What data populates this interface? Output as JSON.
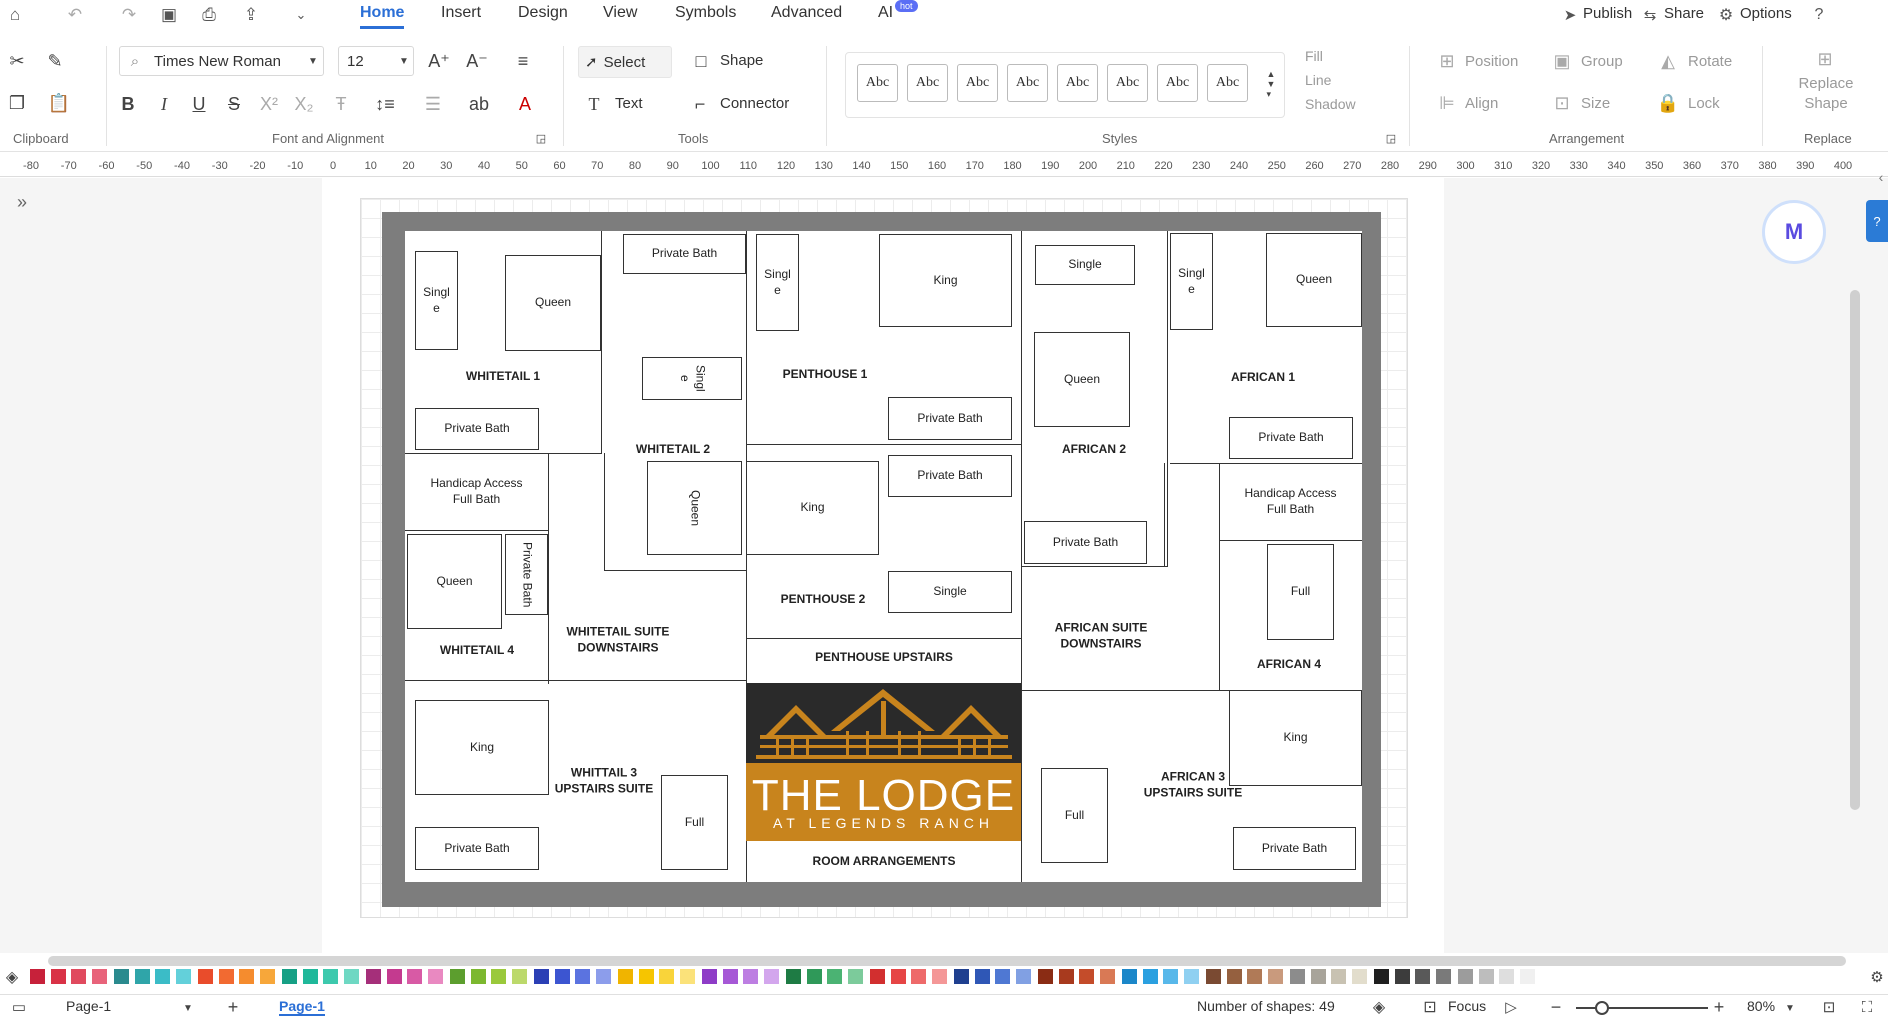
{
  "toolbar": {
    "tabs": [
      "Home",
      "Insert",
      "Design",
      "View",
      "Symbols",
      "Advanced",
      "AI"
    ],
    "hot_badge": "hot",
    "publish": "Publish",
    "share": "Share",
    "options": "Options"
  },
  "ribbon": {
    "font_name": "Times New Roman",
    "font_size": "12",
    "select": "Select",
    "shape": "Shape",
    "text": "Text",
    "connector": "Connector",
    "style_sample": "Abc",
    "fill": "Fill",
    "line": "Line",
    "shadow": "Shadow",
    "position": "Position",
    "group": "Group",
    "rotate": "Rotate",
    "align": "Align",
    "size": "Size",
    "lock": "Lock",
    "replace_shape": "Replace Shape",
    "groups": {
      "clipboard": "Clipboard",
      "font": "Font and Alignment",
      "tools": "Tools",
      "styles": "Styles",
      "arrangement": "Arrangement",
      "replace": "Replace"
    }
  },
  "ruler": [
    "-80",
    "-70",
    "-60",
    "-50",
    "-40",
    "-30",
    "-20",
    "-10",
    "0",
    "10",
    "20",
    "30",
    "40",
    "50",
    "60",
    "70",
    "80",
    "90",
    "100",
    "110",
    "120",
    "130",
    "140",
    "150",
    "160",
    "170",
    "180",
    "190",
    "200",
    "210",
    "220",
    "230",
    "240",
    "250",
    "260",
    "270",
    "280",
    "290",
    "300",
    "310",
    "320",
    "330",
    "340",
    "350",
    "360",
    "370",
    "380",
    "390",
    "400"
  ],
  "rooms": {
    "whitetail1": "WHITETAIL 1",
    "whitetail2": "WHITETAIL 2",
    "whitetail4": "WHITETAIL 4",
    "whitetail_suite": "WHITETAIL SUITE\nDOWNSTAIRS",
    "whittail3": "WHITTAIL 3\nUPSTAIRS SUITE",
    "penthouse1": "PENTHOUSE 1",
    "penthouse2": "PENTHOUSE 2",
    "penthouse_up": "PENTHOUSE UPSTAIRS",
    "african1": "AFRICAN 1",
    "african2": "AFRICAN 2",
    "african4": "AFRICAN 4",
    "african_suite": "AFRICAN SUITE\nDOWNSTAIRS",
    "african3": "AFRICAN 3\nUPSTAIRS SUITE",
    "room_arr": "ROOM ARRANGEMENTS"
  },
  "items": {
    "single_split": "Singl\ne",
    "single": "Single",
    "queen": "Queen",
    "king": "King",
    "full": "Full",
    "private_bath": "Private Bath",
    "handicap": "Handicap Access\nFull Bath"
  },
  "logo": {
    "title": "THE LODGE",
    "subtitle": "AT LEGENDS RANCH"
  },
  "palette": [
    "#c7213a",
    "#d93246",
    "#e04a5e",
    "#e8637a",
    "#2a8a8e",
    "#2fa5a9",
    "#3bbcc7",
    "#63d0da",
    "#e94c2b",
    "#f26a31",
    "#f58c2e",
    "#f7a73a",
    "#16a085",
    "#1fb89a",
    "#3dc9ad",
    "#6ed8c3",
    "#a52f7a",
    "#c43a8f",
    "#d85aa5",
    "#e989c1",
    "#5c9e2e",
    "#7cb82f",
    "#9ac93b",
    "#bcd96b",
    "#2b3fb5",
    "#3c55d1",
    "#5b73e0",
    "#8c9deb",
    "#f0b400",
    "#f6c500",
    "#f9d43a",
    "#fbe27a",
    "#8e3cc7",
    "#a658d6",
    "#bd7ee2",
    "#d3a6ed",
    "#1e7b44",
    "#2f9959",
    "#4bb373",
    "#7ccb9b",
    "#d22f2f",
    "#e64545",
    "#ee6a6a",
    "#f49797",
    "#1f3f8f",
    "#2f57b6",
    "#4f78d3",
    "#81a0e3",
    "#8a2c14",
    "#a83a1e",
    "#c44c2a",
    "#d97955",
    "#1b87c9",
    "#2aa0e0",
    "#58b8ea",
    "#8fd0f1",
    "#7a4a32",
    "#95603f",
    "#b07a57",
    "#c99a7d",
    "#8c8c8c",
    "#a8a49a",
    "#c8c2b2",
    "#e2ddcc",
    "#1f1f1f",
    "#3c3c3c",
    "#595959",
    "#7a7a7a",
    "#9c9c9c",
    "#bdbdbd",
    "#dedede",
    "#f0f0f0"
  ],
  "status": {
    "page_select": "Page-1",
    "page_tab": "Page-1",
    "shape_count": "Number of shapes: 49",
    "focus": "Focus",
    "zoom": "80%"
  }
}
